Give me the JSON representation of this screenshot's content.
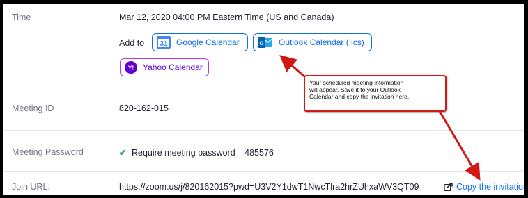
{
  "time": {
    "label": "Time",
    "value": "Mar 12, 2020 04:00 PM Eastern Time (US and Canada)",
    "add_to": "Add to",
    "google": "Google Calendar",
    "outlook": "Outlook Calendar (.ics)",
    "yahoo": "Yahoo Calendar"
  },
  "meeting_id": {
    "label": "Meeting ID",
    "value": "820-162-015"
  },
  "password": {
    "label": "Meeting Password",
    "require": "Require meeting password",
    "value": "485576"
  },
  "join": {
    "label": "Join URL:",
    "url": "https://zoom.us/j/820162015?pwd=U3V2Y1dwT1NwcTlra2hrZUhxaWV3QT09",
    "copy": "Copy the invitation"
  },
  "callout": {
    "line1": "Your scheduled meeting information",
    "line2": "will appear. Save it to your Outlook",
    "line3": "Calendar and copy the invitation here."
  },
  "icons": {
    "google_day": "31",
    "outlook_letter": "o",
    "yahoo_letter": "Y!"
  },
  "colors": {
    "accent": "#0e71eb",
    "yahoo": "#c237d9",
    "callout": "#d21717",
    "check": "#23a566"
  }
}
